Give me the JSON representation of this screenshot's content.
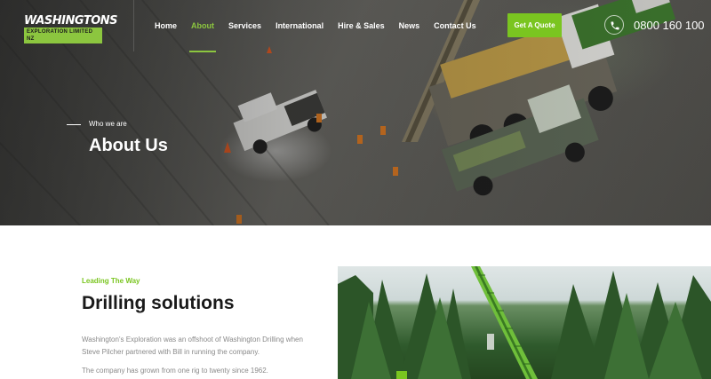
{
  "header": {
    "logo_top": "WASHINGTONS",
    "logo_bottom": "EXPLORATION LIMITED NZ",
    "nav": [
      {
        "label": "Home",
        "active": false
      },
      {
        "label": "About",
        "active": true
      },
      {
        "label": "Services",
        "active": false
      },
      {
        "label": "International",
        "active": false
      },
      {
        "label": "Hire & Sales",
        "active": false
      },
      {
        "label": "News",
        "active": false
      },
      {
        "label": "Contact Us",
        "active": false
      }
    ],
    "cta_label": "Get A Quote",
    "phone_icon": "phone-icon",
    "phone_number": "0800 160 100"
  },
  "hero": {
    "kicker": "Who we are",
    "title": "About Us"
  },
  "content": {
    "kicker": "Leading The Way",
    "heading": "Drilling solutions",
    "para1": "Washington's Exploration was an offshoot of Washington Drilling when Steve Pilcher partnered with Bill in running the company.",
    "para2": "The company has grown from one rig to twenty since 1962."
  },
  "colors": {
    "accent": "#7ac520",
    "heading": "#1a1a1a",
    "body_text": "#8a8a8a"
  }
}
